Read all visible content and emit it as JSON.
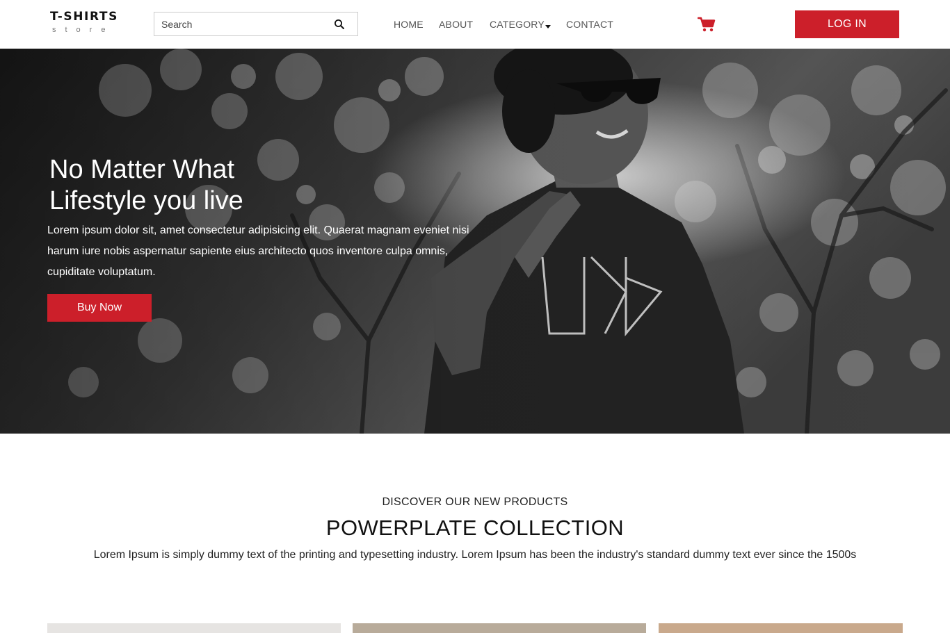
{
  "logo": {
    "main": "T-SHIRTS",
    "sub": "store"
  },
  "search": {
    "placeholder": "Search",
    "value": ""
  },
  "nav": {
    "home": "HOME",
    "about": "ABOUT",
    "category": "CATEGORY",
    "contact": "CONTACT"
  },
  "header": {
    "login_label": "LOG IN"
  },
  "hero": {
    "title_line1": "No Matter What",
    "title_line2": "Lifestyle you live",
    "text": "Lorem ipsum dolor sit, amet consectetur adipisicing elit. Quaerat magnam eveniet nisi harum iure nobis aspernatur sapiente eius architecto quos inventore culpa omnis, cupiditate voluptatum.",
    "cta_label": "Buy Now"
  },
  "products": {
    "kicker": "DISCOVER OUR NEW PRODUCTS",
    "title": "POWERPLATE COLLECTION",
    "text": "Lorem Ipsum is simply dummy text of the printing and typesetting industry. Lorem Ipsum has been the industry's standard dummy text ever since the 1500s"
  },
  "icons": {
    "search": "search-icon",
    "cart": "shopping-cart-icon",
    "category": "caret-down-icon"
  },
  "colors": {
    "accent": "#cc1f2a",
    "nav_text": "#555555",
    "hero_bg": "#2d2d2d"
  }
}
